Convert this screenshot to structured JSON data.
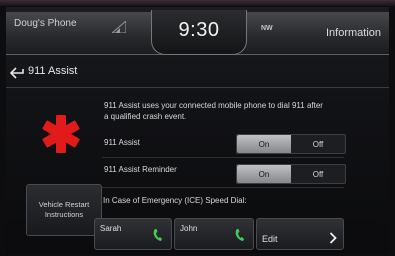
{
  "status": {
    "phone_name": "Doug's Phone",
    "time": "9:30",
    "compass": "NW",
    "info_label": "Information"
  },
  "header": {
    "title": "911 Assist"
  },
  "description": "911 Assist uses your connected mobile phone to dial 911 after a qualified crash event.",
  "settings": [
    {
      "label": "911 Assist",
      "on_label": "On",
      "off_label": "Off",
      "selected": "On"
    },
    {
      "label": "911 Assist Reminder",
      "on_label": "On",
      "off_label": "Off",
      "selected": "On"
    }
  ],
  "vehicle_restart_button": "Vehicle Restart Instructions",
  "ice": {
    "label": "In Case of Emergency (ICE) Speed Dial:",
    "contacts": [
      {
        "name": "Sarah"
      },
      {
        "name": "John"
      }
    ],
    "edit_label": "Edit"
  },
  "colors": {
    "accent_green": "#3ecf55",
    "star_red": "#e11a1a"
  },
  "icons": {
    "back": "back-arrow-icon",
    "signal": "signal-icon",
    "star": "star-of-life-icon",
    "phone": "phone-icon",
    "chevron": "chevron-right-icon"
  }
}
